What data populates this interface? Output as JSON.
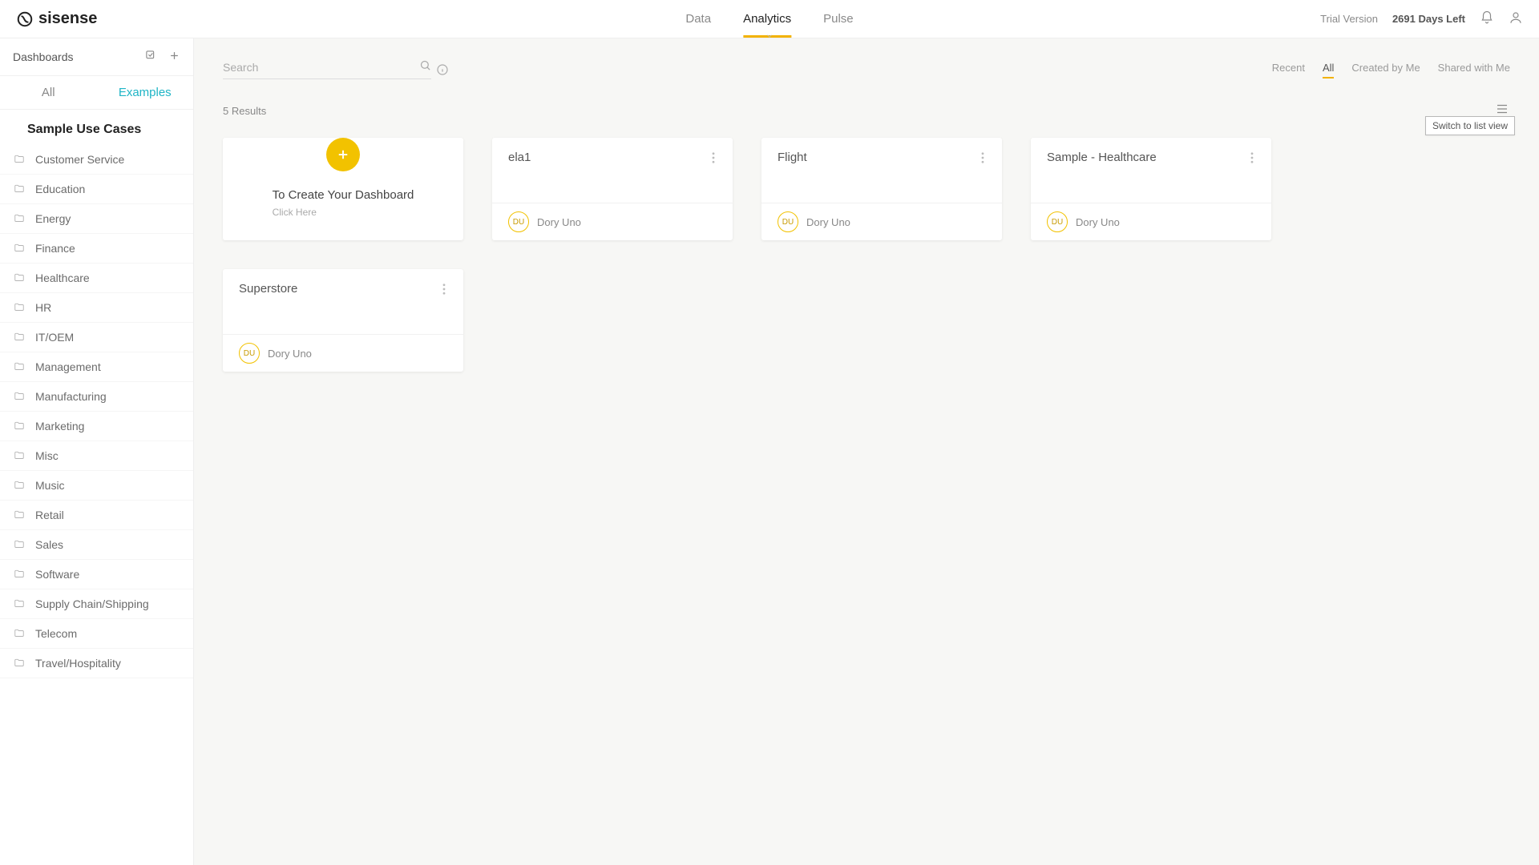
{
  "brand": "sisense",
  "topnav": [
    "Data",
    "Analytics",
    "Pulse"
  ],
  "topnav_active_index": 1,
  "trial": {
    "label": "Trial Version",
    "days": "2691 Days Left"
  },
  "sidebar": {
    "title": "Dashboards",
    "tabs": [
      "All",
      "Examples"
    ],
    "tabs_active_index": 1,
    "section_title": "Sample Use Cases",
    "folders": [
      "Customer Service",
      "Education",
      "Energy",
      "Finance",
      "Healthcare",
      "HR",
      "IT/OEM",
      "Management",
      "Manufacturing",
      "Marketing",
      "Misc",
      "Music",
      "Retail",
      "Sales",
      "Software",
      "Supply Chain/Shipping",
      "Telecom",
      "Travel/Hospitality"
    ]
  },
  "search": {
    "placeholder": "Search"
  },
  "filters": [
    "Recent",
    "All",
    "Created by Me",
    "Shared with Me"
  ],
  "filters_active_index": 1,
  "results": {
    "count_label": "5 Results"
  },
  "view_toggle_tooltip": "Switch to list view",
  "create_card": {
    "title": "To Create Your Dashboard",
    "sub": "Click Here"
  },
  "cards": [
    {
      "title": "ela1",
      "owner_initials": "DU",
      "owner_name": "Dory Uno"
    },
    {
      "title": "Flight",
      "owner_initials": "DU",
      "owner_name": "Dory Uno"
    },
    {
      "title": "Sample - Healthcare",
      "owner_initials": "DU",
      "owner_name": "Dory Uno"
    },
    {
      "title": "Superstore",
      "owner_initials": "DU",
      "owner_name": "Dory Uno"
    }
  ]
}
